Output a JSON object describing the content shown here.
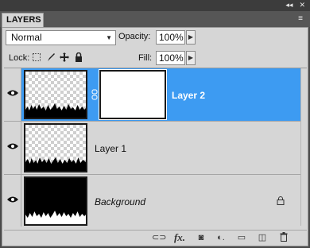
{
  "panel": {
    "tab_title": "LAYERS",
    "collapse_glyph": "◂◂",
    "close_glyph": "✕",
    "menu_glyph": "≡"
  },
  "blend": {
    "mode": "Normal"
  },
  "opacity": {
    "label": "Opacity:",
    "value": "100%"
  },
  "lock": {
    "label": "Lock:"
  },
  "fill": {
    "label": "Fill:",
    "value": "100%"
  },
  "layers": [
    {
      "name": "Layer 2",
      "selected": true,
      "visible": true,
      "has_mask": true
    },
    {
      "name": "Layer 1",
      "selected": false,
      "visible": true
    },
    {
      "name": "Background",
      "selected": false,
      "visible": true,
      "locked": true
    }
  ],
  "toolbar": {
    "link_glyph": "⊂⊃",
    "fx_label": "fx.",
    "mask_glyph": "◙",
    "adjust_glyph": "◐.",
    "group_glyph": "▭",
    "new_glyph": "◫",
    "trash_glyph": "🗑"
  },
  "colors": {
    "selection": "#3d9bf2",
    "panel_bg": "#d6d6d6",
    "frame_bg": "#4a4a4a"
  },
  "icons": [
    "eye-icon",
    "chain-link-icon",
    "lock-icon",
    "lock-transparent-icon",
    "brush-icon",
    "move-icon",
    "trash-icon",
    "fx-icon"
  ]
}
